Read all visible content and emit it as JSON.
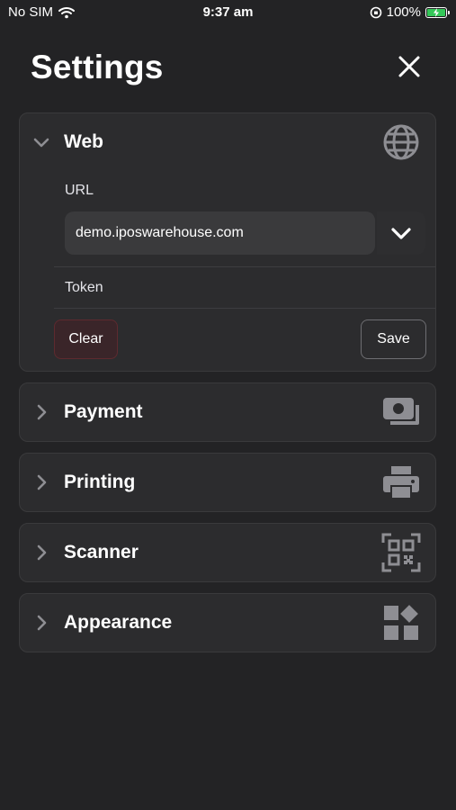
{
  "status_bar": {
    "carrier": "No SIM",
    "time": "9:37 am",
    "battery": "100%"
  },
  "header": {
    "title": "Settings"
  },
  "web": {
    "title": "Web",
    "url_label": "URL",
    "url_value": "demo.iposwarehouse.com",
    "token_label": "Token",
    "clear_label": "Clear",
    "save_label": "Save"
  },
  "sections": {
    "payment": "Payment",
    "printing": "Printing",
    "scanner": "Scanner",
    "appearance": "Appearance"
  },
  "colors": {
    "background": "#232325",
    "card": "#2c2c2e",
    "icon": "#8e8e93",
    "battery": "#34c759",
    "danger_border": "#5e2a2f"
  },
  "icons": [
    "globe-icon",
    "payment-icon",
    "printer-icon",
    "qr-scan-icon",
    "apps-icon"
  ]
}
